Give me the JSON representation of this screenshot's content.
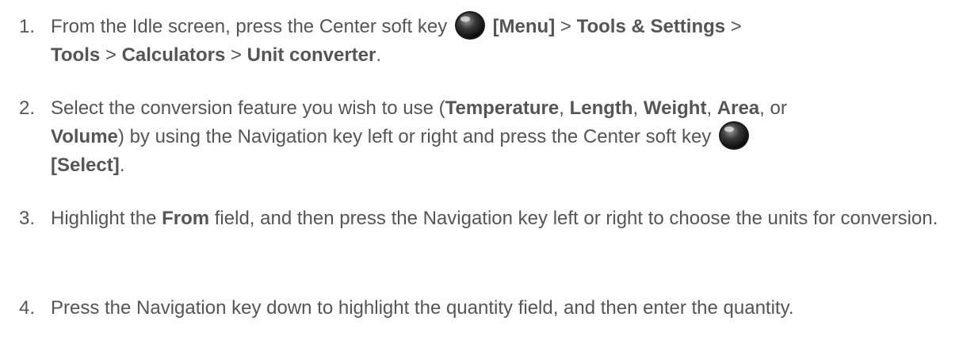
{
  "steps": [
    {
      "number": "1.",
      "parts": {
        "t1": "From the Idle screen, press the Center soft key",
        "b1": "[Menu]",
        "t2": " > ",
        "b2": "Tools & Settings",
        "t3": " > ",
        "b3": "Tools",
        "t4": " > ",
        "b4": "Calculators",
        "t5": " > ",
        "b5": "Unit converter",
        "t6": "."
      }
    },
    {
      "number": "2.",
      "parts": {
        "t1": "Select the conversion feature you wish to use (",
        "b1": "Temperature",
        "t2": ", ",
        "b2": "Length",
        "t3": ", ",
        "b3": "Weight",
        "t4": ", ",
        "b4": "Area",
        "t5": ", or ",
        "b5": "Volume",
        "t6": ") by using the Navigation key left or right and press the Center soft key",
        "b6": "[Select]",
        "t7": "."
      }
    },
    {
      "number": "3.",
      "parts": {
        "t1": "Highlight the ",
        "b1": "From",
        "t2": " field, and then press the Navigation key left or right to choose the units for conversion."
      }
    },
    {
      "number": "4.",
      "parts": {
        "t1": "Press the Navigation key down to highlight the quantity field, and then enter the quantity."
      }
    }
  ],
  "icons": {
    "center_key": "center-soft-key-icon"
  }
}
